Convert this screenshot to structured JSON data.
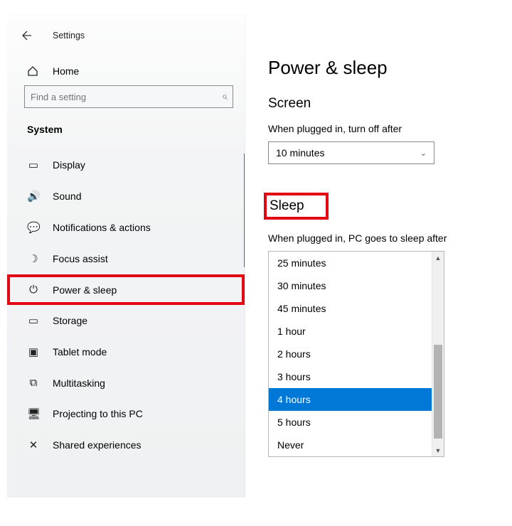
{
  "header": {
    "app_title": "Settings",
    "home_label": "Home"
  },
  "search": {
    "placeholder": "Find a setting"
  },
  "section_header": "System",
  "nav": [
    {
      "icon": "display-icon",
      "glyph": "▭",
      "label": "Display"
    },
    {
      "icon": "sound-icon",
      "glyph": "🔊",
      "label": "Sound"
    },
    {
      "icon": "notifications-icon",
      "glyph": "💬",
      "label": "Notifications & actions"
    },
    {
      "icon": "focus-assist-icon",
      "glyph": "☽",
      "label": "Focus assist"
    },
    {
      "icon": "power-sleep-icon",
      "glyph": "⏻",
      "label": "Power & sleep",
      "highlight": true
    },
    {
      "icon": "storage-icon",
      "glyph": "▭",
      "label": "Storage"
    },
    {
      "icon": "tablet-mode-icon",
      "glyph": "▣",
      "label": "Tablet mode"
    },
    {
      "icon": "multitasking-icon",
      "glyph": "⧉",
      "label": "Multitasking"
    },
    {
      "icon": "projecting-icon",
      "glyph": "🖥",
      "label": "Projecting to this PC"
    },
    {
      "icon": "shared-exp-icon",
      "glyph": "✕",
      "label": "Shared experiences"
    }
  ],
  "page": {
    "title": "Power & sleep",
    "section_screen": "Screen",
    "screen_label": "When plugged in, turn off after",
    "screen_value": "10 minutes",
    "section_sleep": "Sleep",
    "sleep_label": "When plugged in, PC goes to sleep after",
    "sleep_options": [
      "25 minutes",
      "30 minutes",
      "45 minutes",
      "1 hour",
      "2 hours",
      "3 hours",
      "4 hours",
      "5 hours",
      "Never"
    ],
    "sleep_selected": "4 hours"
  }
}
